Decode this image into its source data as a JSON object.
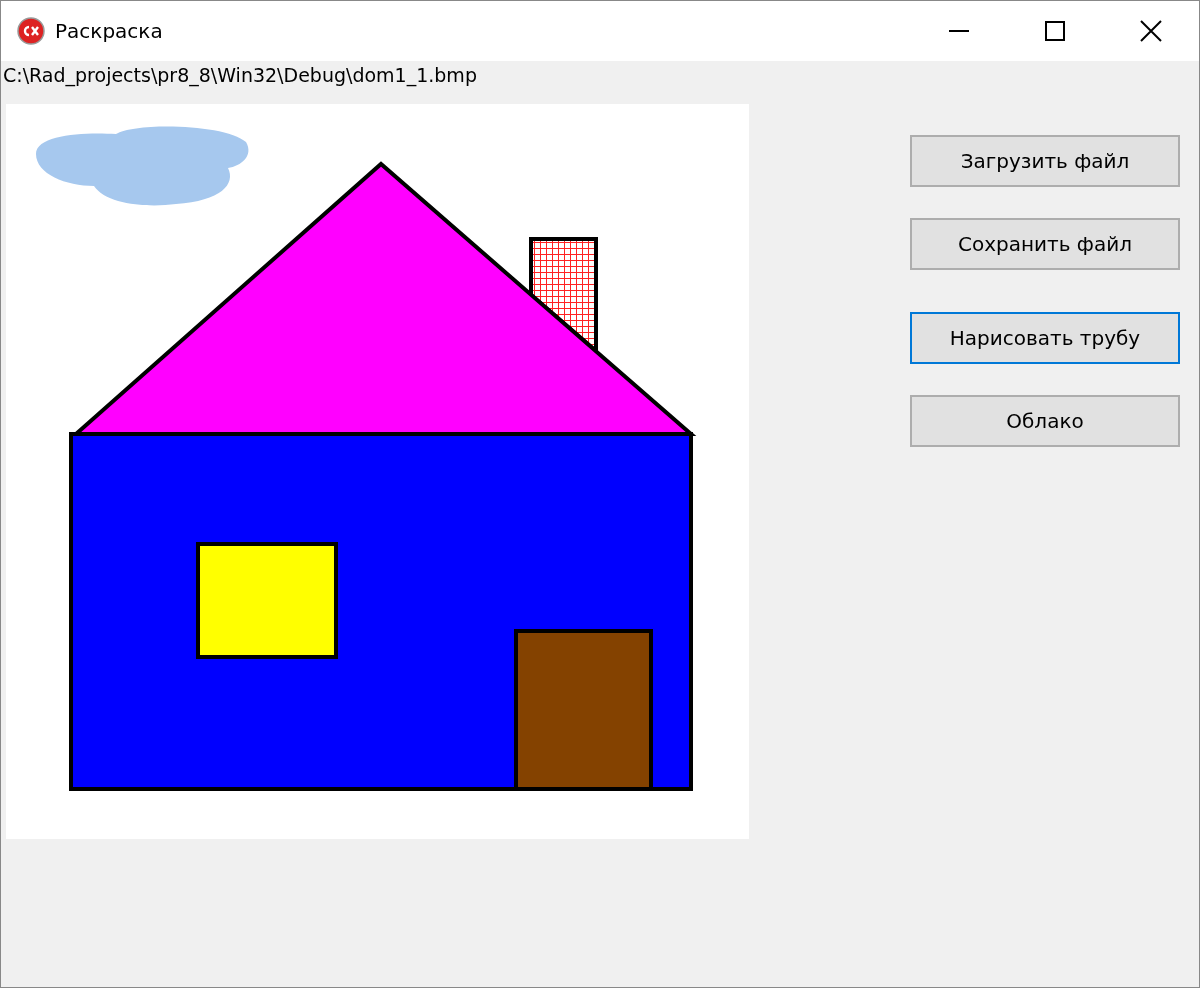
{
  "window": {
    "title": "Раскраска"
  },
  "path_label": "C:\\Rad_projects\\pr8_8\\Win32\\Debug\\dom1_1.bmp",
  "buttons": [
    {
      "label": "Загрузить файл",
      "focused": false
    },
    {
      "label": "Сохранить файл",
      "focused": false
    },
    {
      "label": "Нарисовать трубу",
      "focused": true
    },
    {
      "label": "Облако",
      "focused": false
    }
  ]
}
